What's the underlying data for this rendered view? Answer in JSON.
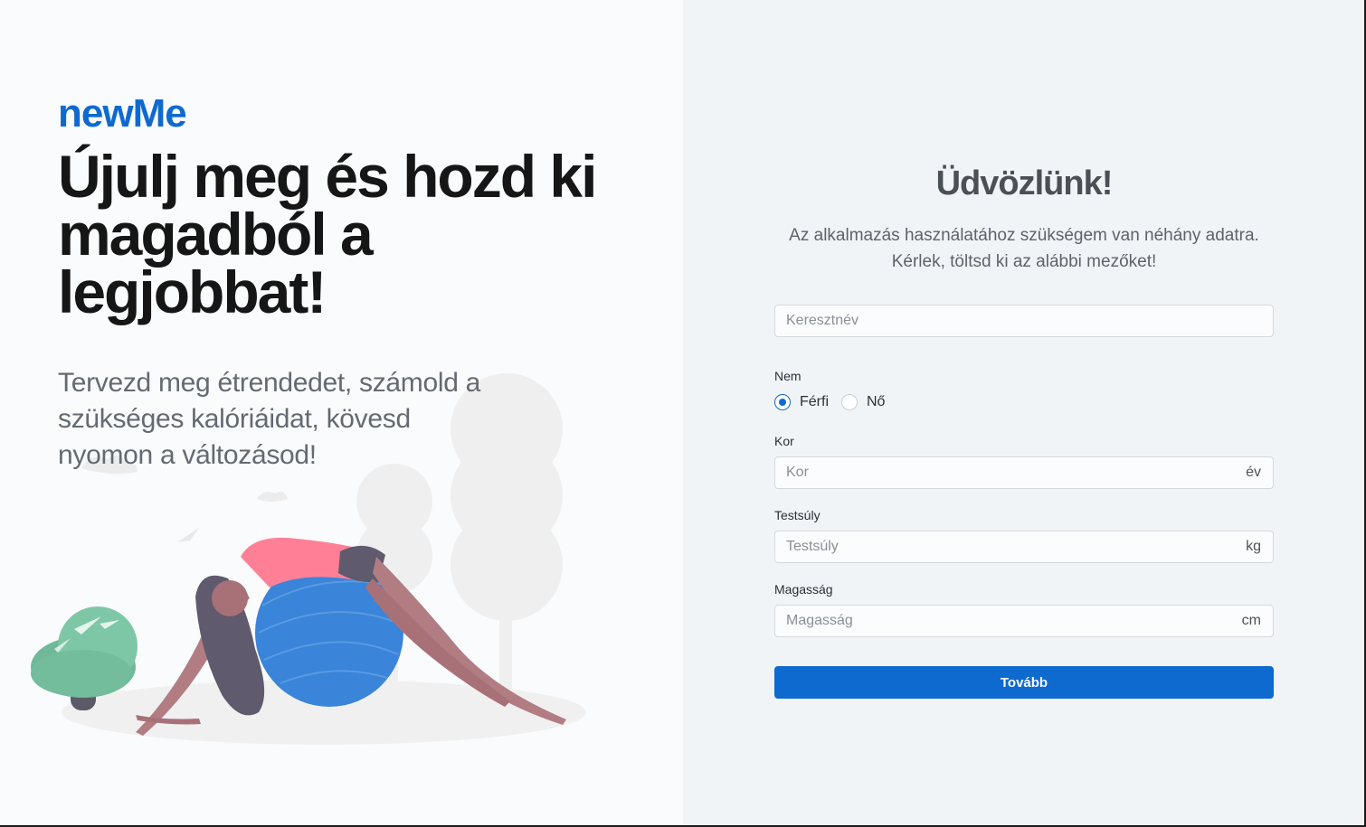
{
  "brand": {
    "name": "newMe"
  },
  "hero": {
    "headline": "Újulj meg és hozd ki magadból a legjobbat!",
    "subtext": "Tervezd meg étrendedet, számold a szükséges kalóriáidat, kövesd nyomon a változásod!"
  },
  "form": {
    "title": "Üdvözlünk!",
    "intro_line1": "Az alkalmazás használatához szükségem van néhány adatra.",
    "intro_line2": "Kérlek, töltsd ki az alábbi mezőket!",
    "firstname": {
      "placeholder": "Keresztnév",
      "value": ""
    },
    "gender": {
      "label": "Nem",
      "options": [
        {
          "label": "Férfi",
          "selected": true
        },
        {
          "label": "Nő",
          "selected": false
        }
      ]
    },
    "age": {
      "label": "Kor",
      "placeholder": "Kor",
      "unit": "év",
      "value": ""
    },
    "weight": {
      "label": "Testsúly",
      "placeholder": "Testsúly",
      "unit": "kg",
      "value": ""
    },
    "height": {
      "label": "Magasság",
      "placeholder": "Magasság",
      "unit": "cm",
      "value": ""
    },
    "submit_label": "Tovább"
  },
  "colors": {
    "accent": "#0f6ad0",
    "left_background": "#fafbfc",
    "right_background": "#f1f4f7",
    "headline": "#161616"
  },
  "illustration": {
    "name": "woman-stretching-on-exercise-ball-illustration"
  }
}
